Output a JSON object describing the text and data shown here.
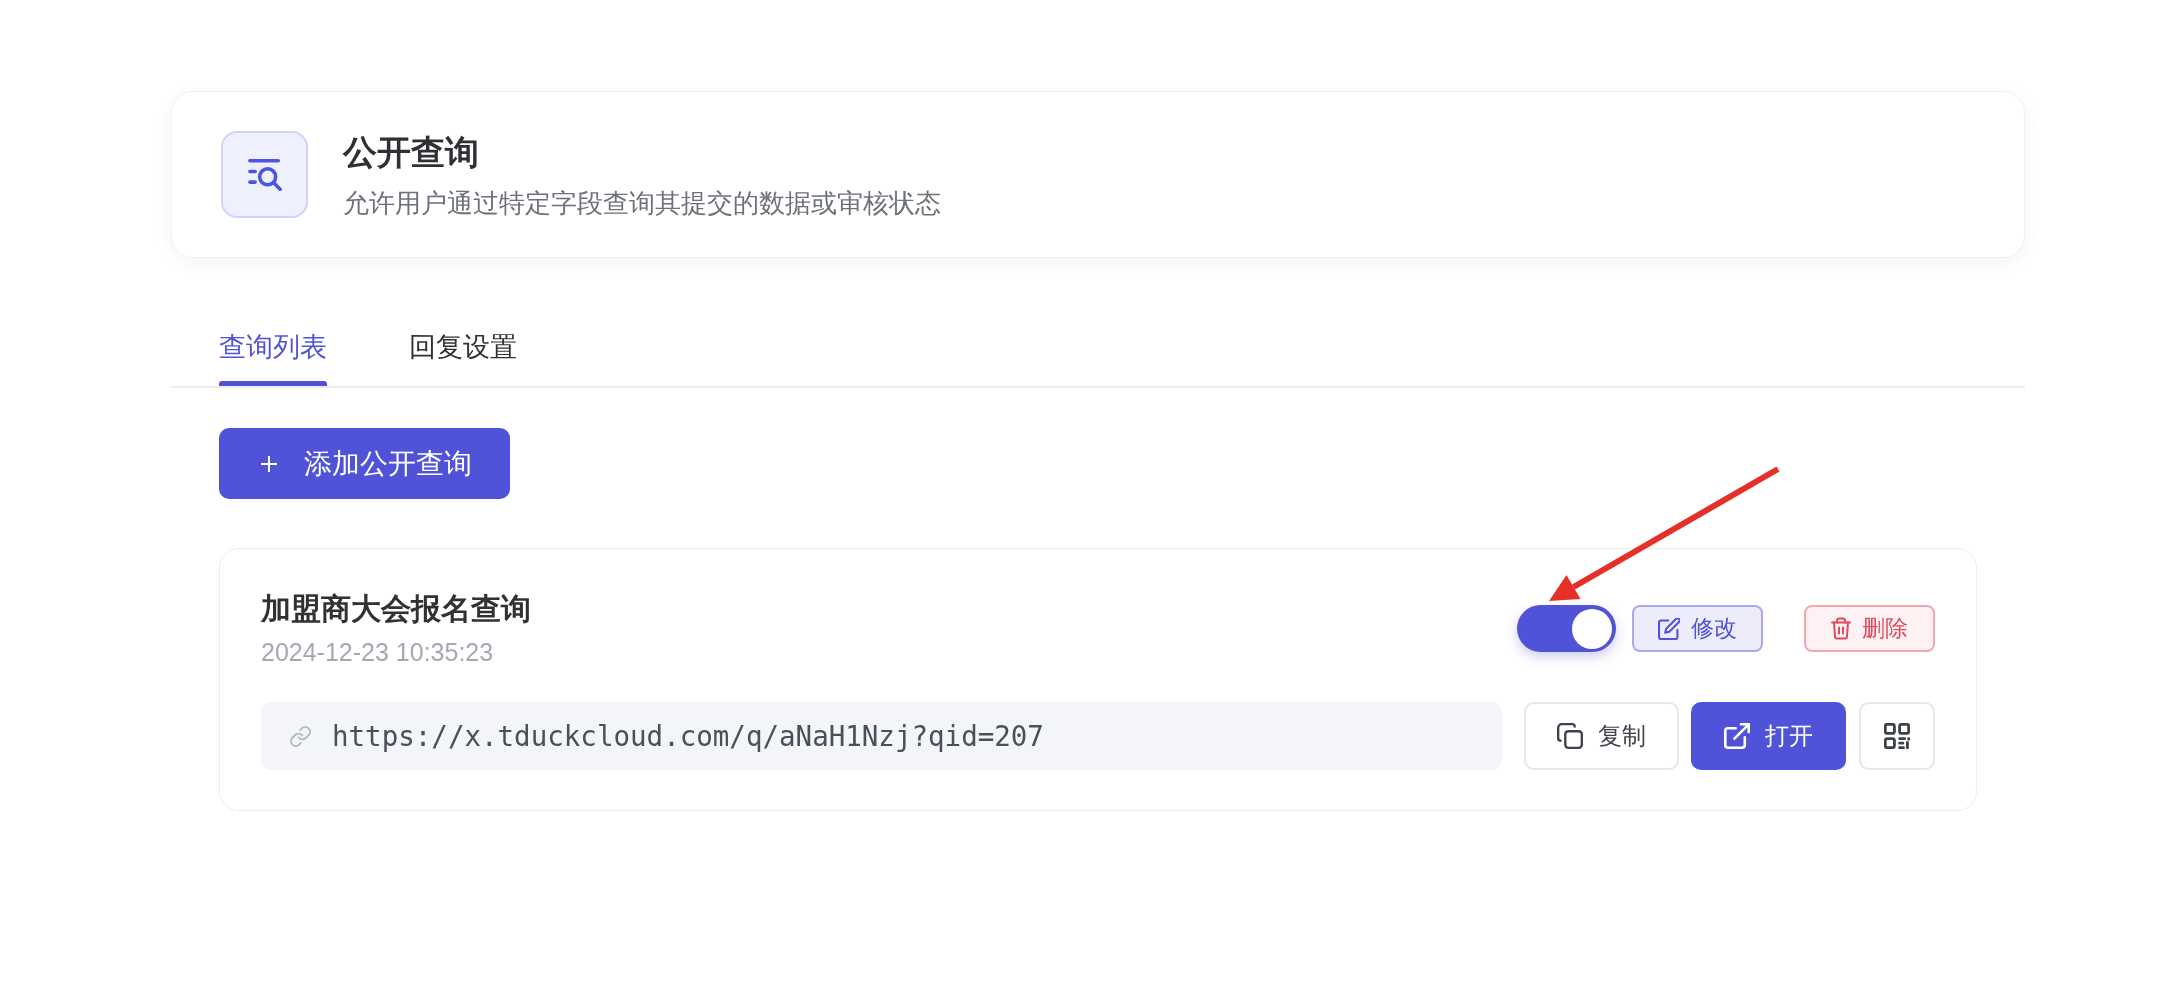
{
  "header": {
    "title": "公开查询",
    "description": "允许用户通过特定字段查询其提交的数据或审核状态"
  },
  "tabs": [
    {
      "label": "查询列表",
      "selected": true
    },
    {
      "label": "回复设置",
      "selected": false
    }
  ],
  "add_button": {
    "label": "添加公开查询"
  },
  "queries": [
    {
      "title": "加盟商大会报名查询",
      "created": "2024-12-23 10:35:23",
      "enabled": true,
      "edit_label": "修改",
      "delete_label": "删除",
      "url": "https://x.tduckcloud.com/q/aNaH1Nzj?qid=207",
      "copy_label": "复制",
      "open_label": "打开"
    }
  ]
}
